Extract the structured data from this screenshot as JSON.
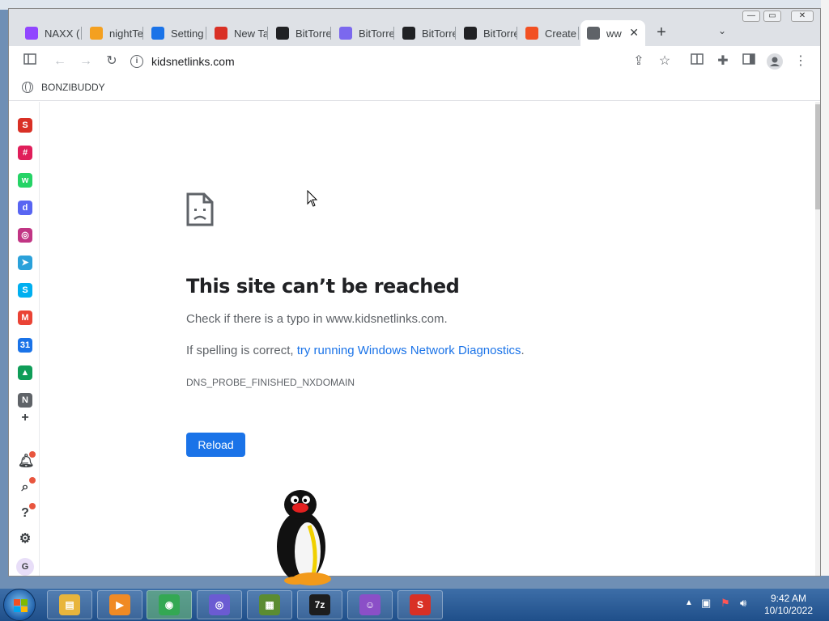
{
  "tabs": [
    {
      "title": "NAXX (",
      "favicon": "twitch-icon",
      "color": "#9146ff"
    },
    {
      "title": "nightTe",
      "favicon": "rainbow-icon",
      "color": "#f4a020"
    },
    {
      "title": "Setting",
      "favicon": "gear-icon",
      "color": "#1a73e8"
    },
    {
      "title": "New Ta",
      "favicon": "s-logo-icon",
      "color": "#d93025"
    },
    {
      "title": "BitTorre",
      "favicon": "b-logo-icon",
      "color": "#202124"
    },
    {
      "title": "BitTorre",
      "favicon": "speed-icon",
      "color": "#7b68ee"
    },
    {
      "title": "BitTorre",
      "favicon": "b-logo-icon",
      "color": "#202124"
    },
    {
      "title": "BitTorre",
      "favicon": "b-logo-icon",
      "color": "#202124"
    },
    {
      "title": "Create",
      "favicon": "microsoft-icon",
      "color": "#f25022"
    },
    {
      "title": "ww",
      "favicon": "globe-icon",
      "color": "#5f6368",
      "active": true
    }
  ],
  "address_bar": {
    "url": "kidsnetlinks.com"
  },
  "bookmarks": [
    {
      "label": "BONZIBUDDY"
    }
  ],
  "sidebar": [
    {
      "name": "s-app-icon",
      "color": "#d93025",
      "glyph": "S"
    },
    {
      "name": "slack-icon",
      "color": "#e01e5a",
      "glyph": "#"
    },
    {
      "name": "whatsapp-icon",
      "color": "#25d366",
      "glyph": "w"
    },
    {
      "name": "discord-icon",
      "color": "#5865f2",
      "glyph": "d"
    },
    {
      "name": "instagram-icon",
      "color": "#c13584",
      "glyph": "◎"
    },
    {
      "name": "telegram-icon",
      "color": "#2aa1da",
      "glyph": "➤"
    },
    {
      "name": "skype-icon",
      "color": "#00aff0",
      "glyph": "S"
    },
    {
      "name": "gmail-icon",
      "color": "#ea4335",
      "glyph": "M"
    },
    {
      "name": "calendar-icon",
      "color": "#1a73e8",
      "glyph": "31"
    },
    {
      "name": "drive-icon",
      "color": "#0f9d58",
      "glyph": "▲"
    },
    {
      "name": "notion-icon",
      "color": "#5f6368",
      "glyph": "N"
    }
  ],
  "error": {
    "title": "This site can’t be reached",
    "typo_line": "Check if there is a typo in www.kidsnetlinks.com.",
    "diag_prefix": "If spelling is correct, ",
    "diag_link": "try running Windows Network Diagnostics",
    "diag_suffix": ".",
    "code": "DNS_PROBE_FINISHED_NXDOMAIN",
    "reload_label": "Reload"
  },
  "sidebar_bottom": {
    "avatar_letter": "G"
  },
  "taskbar": {
    "apps": [
      {
        "name": "file-explorer-icon",
        "color": "#e8b53c",
        "glyph": "▤"
      },
      {
        "name": "media-player-icon",
        "color": "#f08a24",
        "glyph": "▶"
      },
      {
        "name": "chrome-icon",
        "color": "#34a853",
        "glyph": "◉",
        "active": true
      },
      {
        "name": "bittorrent-icon",
        "color": "#6b5bd2",
        "glyph": "◎"
      },
      {
        "name": "minecraft-icon",
        "color": "#5b8c32",
        "glyph": "▦"
      },
      {
        "name": "7zip-icon",
        "color": "#1d1d1d",
        "glyph": "7z"
      },
      {
        "name": "bonzi-icon",
        "color": "#8b4fc7",
        "glyph": "☺"
      },
      {
        "name": "s-app-taskbar-icon",
        "color": "#d93025",
        "glyph": "S"
      }
    ],
    "time": "9:42 AM",
    "date": "10/10/2022"
  }
}
